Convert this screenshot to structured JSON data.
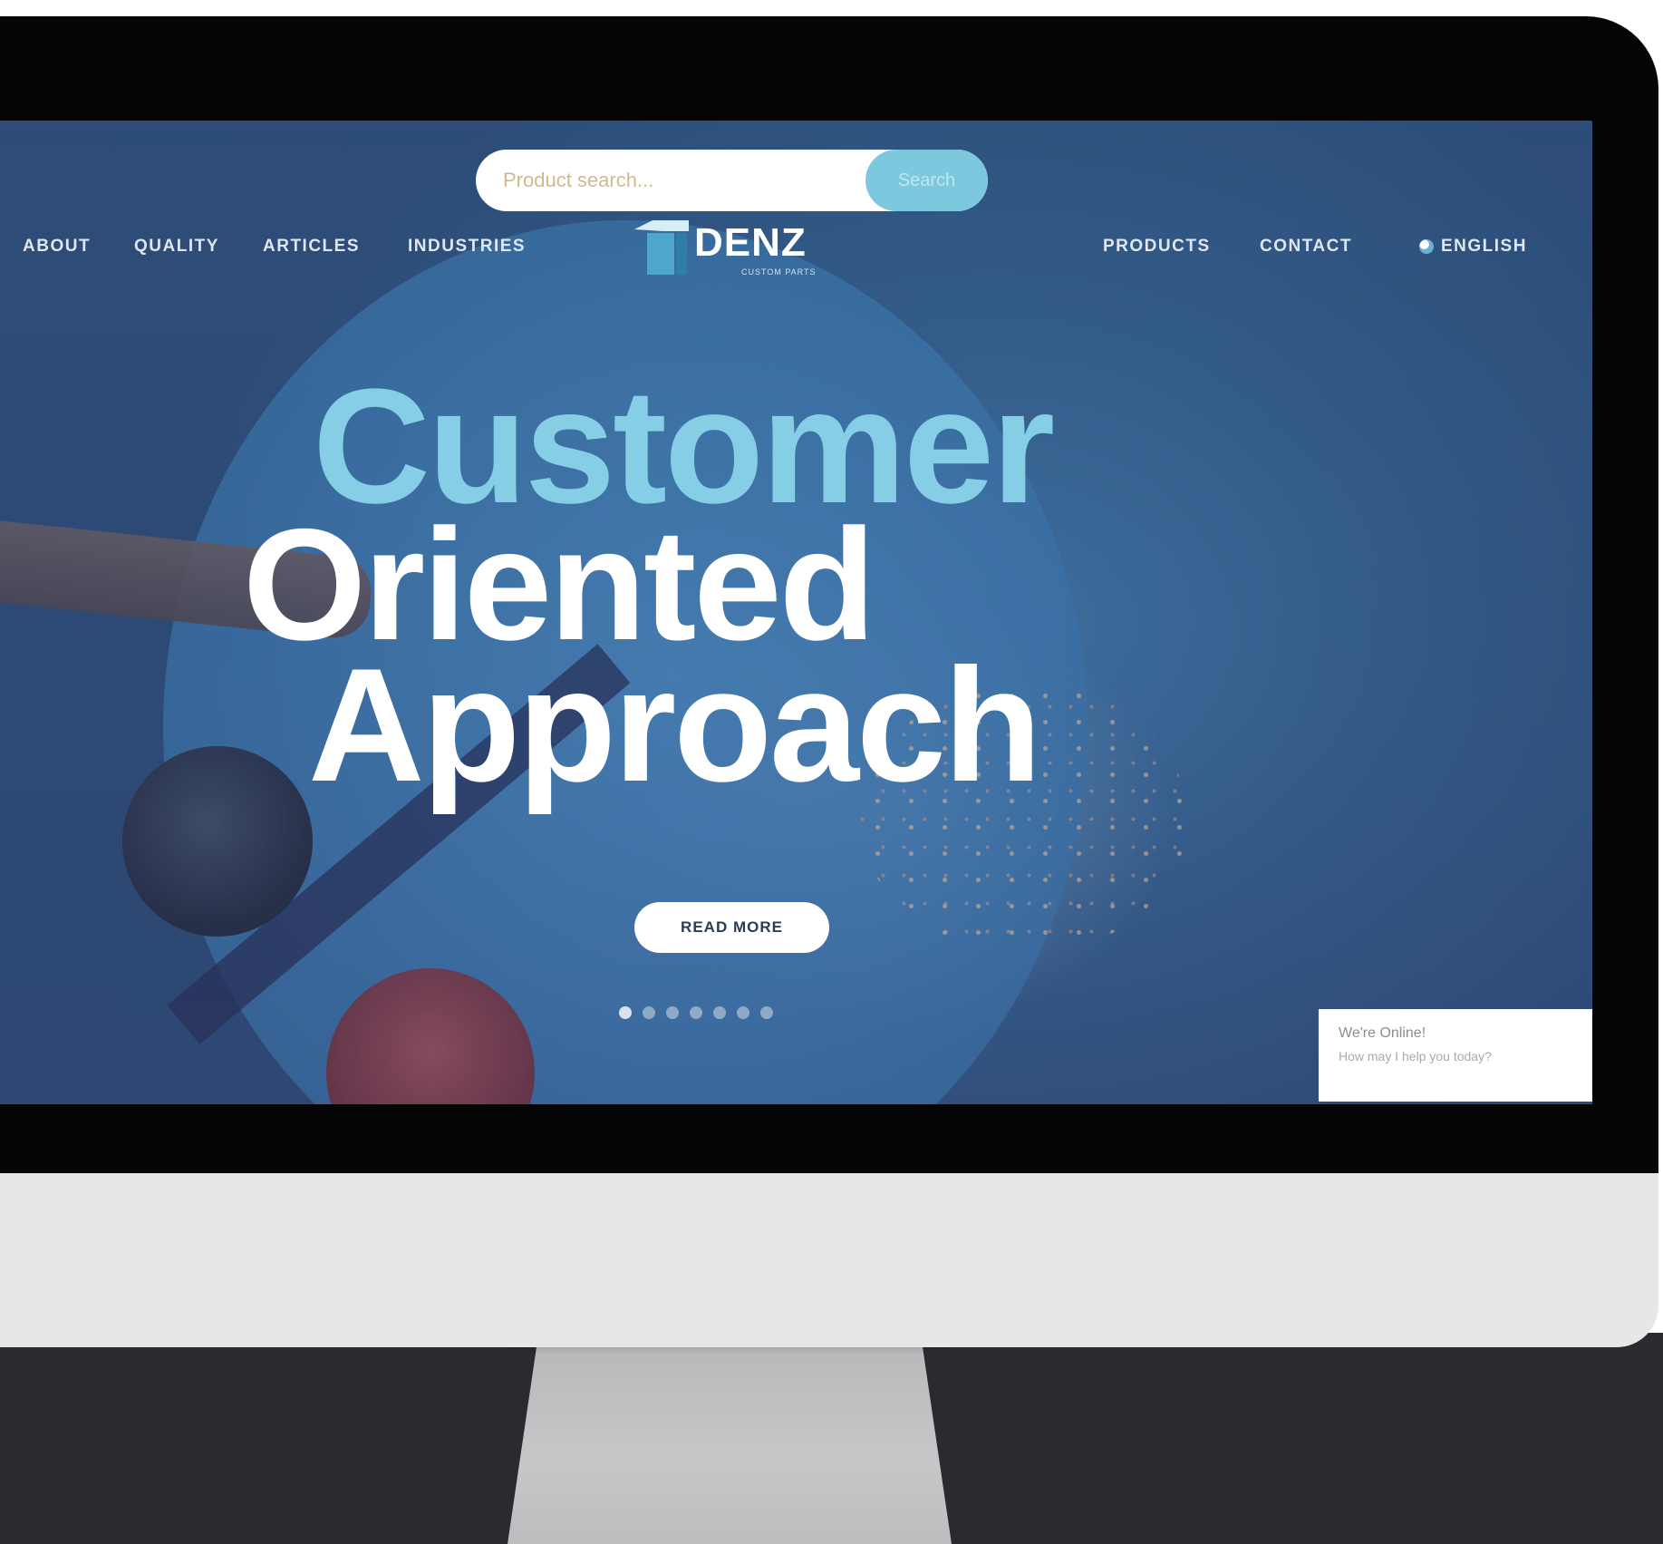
{
  "search": {
    "placeholder": "Product search...",
    "button_label": "Search"
  },
  "nav": {
    "left": [
      "ABOUT",
      "QUALITY",
      "ARTICLES",
      "INDUSTRIES"
    ],
    "right": [
      "PRODUCTS",
      "CONTACT"
    ]
  },
  "logo": {
    "name": "DENZ",
    "tagline": "CUSTOM PARTS"
  },
  "language": {
    "label": "ENGLISH",
    "icon": "globe-icon"
  },
  "hero": {
    "line1": "Customer",
    "line2": "Oriented",
    "line3": "Approach",
    "cta": "READ MORE"
  },
  "slider": {
    "total": 7,
    "active": 1
  },
  "chat": {
    "title": "We're Online!",
    "subtitle": "How may I help you today?"
  },
  "colors": {
    "accent": "#7cc8de",
    "hero_highlight": "#86cde6",
    "monitor_bezel": "#050505",
    "monitor_chin": "#e7e7e7",
    "stand": "#c2c2c4"
  }
}
